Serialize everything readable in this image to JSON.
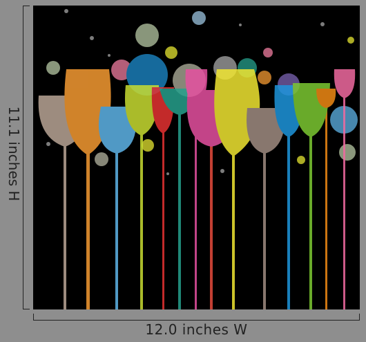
{
  "dimensions": {
    "height_label": "11.1 inches H",
    "width_label": "12.0 inches W"
  },
  "artwork": {
    "background": "#000000",
    "glass_colors": [
      "#b9a596",
      "#f59a32",
      "#5fb4e8",
      "#c8dc32",
      "#e63232",
      "#26a08c",
      "#e650a0",
      "#e64a3c",
      "#f0e632",
      "#a08c82",
      "#1e96dc",
      "#7cc832",
      "#f08a14",
      "#f06aa0"
    ]
  }
}
